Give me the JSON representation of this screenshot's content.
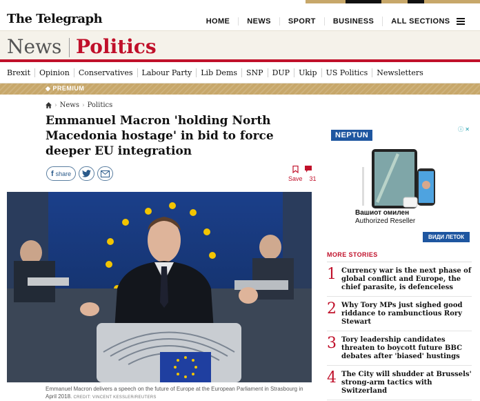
{
  "masthead": {
    "logo": "The Telegraph",
    "nav": [
      "HOME",
      "NEWS",
      "SPORT",
      "BUSINESS",
      "ALL SECTIONS"
    ]
  },
  "section": {
    "parent": "News",
    "name": "Politics"
  },
  "subnav": [
    "Brexit",
    "Opinion",
    "Conservatives",
    "Labour Party",
    "Lib Dems",
    "SNP",
    "DUP",
    "Ukip",
    "US Politics",
    "Newsletters"
  ],
  "premium_label": "PREMIUM",
  "breadcrumb": [
    "News",
    "Politics"
  ],
  "article": {
    "headline": "Emmanuel Macron 'holding North Macedonia hostage' in bid to force deeper EU integration",
    "share_label": "share",
    "save_label": "Save",
    "comment_count": "31",
    "caption": "Emmanuel Macron delivers a speech on the future of Europe at the European Parliament in Strasbourg in April 2018.",
    "credit": "CREDIT: VINCENT KESSLER/REUTERS"
  },
  "ad": {
    "brand": "NEPTUN",
    "line1": "Вашиот омилен",
    "line2": "Authorized Reseller",
    "cta": "ВИДИ ЛЕТОК"
  },
  "more_stories": {
    "title": "MORE STORIES",
    "items": [
      {
        "num": "1",
        "text": "Currency war is the next phase of global conflict and Europe, the chief parasite, is defenceless"
      },
      {
        "num": "2",
        "text": "Why Tory MPs just sighed good riddance to rambunctious Rory Stewart"
      },
      {
        "num": "3",
        "text": "Tory leadership candidates threaten to boycott future BBC debates after 'biased' hustings"
      },
      {
        "num": "4",
        "text": "The City will shudder at Brussels' strong-arm tactics with Switzerland"
      }
    ]
  },
  "colors": {
    "brand_red": "#c0102a",
    "premium_gold": "#c7a76a",
    "link_blue": "#2a5a8a"
  }
}
